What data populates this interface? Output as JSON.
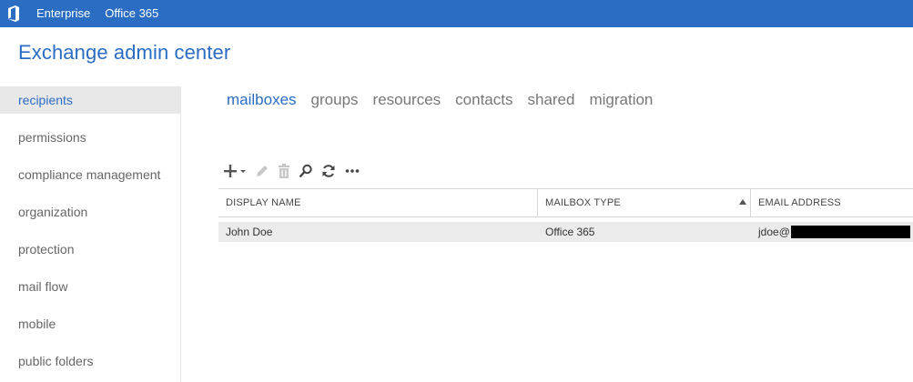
{
  "topbar": {
    "logo_icon": "office-logo-icon",
    "links": [
      "Enterprise",
      "Office 365"
    ],
    "bg_color": "#2a6dc3"
  },
  "app_title": "Exchange admin center",
  "sidebar": {
    "items": [
      {
        "label": "recipients",
        "selected": true
      },
      {
        "label": "permissions"
      },
      {
        "label": "compliance management"
      },
      {
        "label": "organization"
      },
      {
        "label": "protection"
      },
      {
        "label": "mail flow"
      },
      {
        "label": "mobile"
      },
      {
        "label": "public folders"
      }
    ]
  },
  "tabs": [
    {
      "label": "mailboxes",
      "active": true
    },
    {
      "label": "groups"
    },
    {
      "label": "resources"
    },
    {
      "label": "contacts"
    },
    {
      "label": "shared"
    },
    {
      "label": "migration"
    }
  ],
  "toolbar": {
    "buttons": [
      "add-icon",
      "edit-icon",
      "delete-icon",
      "search-icon",
      "refresh-icon",
      "more-icon"
    ]
  },
  "table": {
    "columns": [
      "DISPLAY NAME",
      "MAILBOX TYPE",
      "EMAIL ADDRESS"
    ],
    "sorted_column": "MAILBOX TYPE",
    "sort_direction": "ascending",
    "rows": [
      {
        "display_name": "John Doe",
        "mailbox_type": "Office 365",
        "email_address": "jdoe@"
      }
    ]
  },
  "colors": {
    "accent": "#2a6dc3",
    "selected_bg": "#e8e8e8",
    "row_bg": "#ebebeb"
  }
}
